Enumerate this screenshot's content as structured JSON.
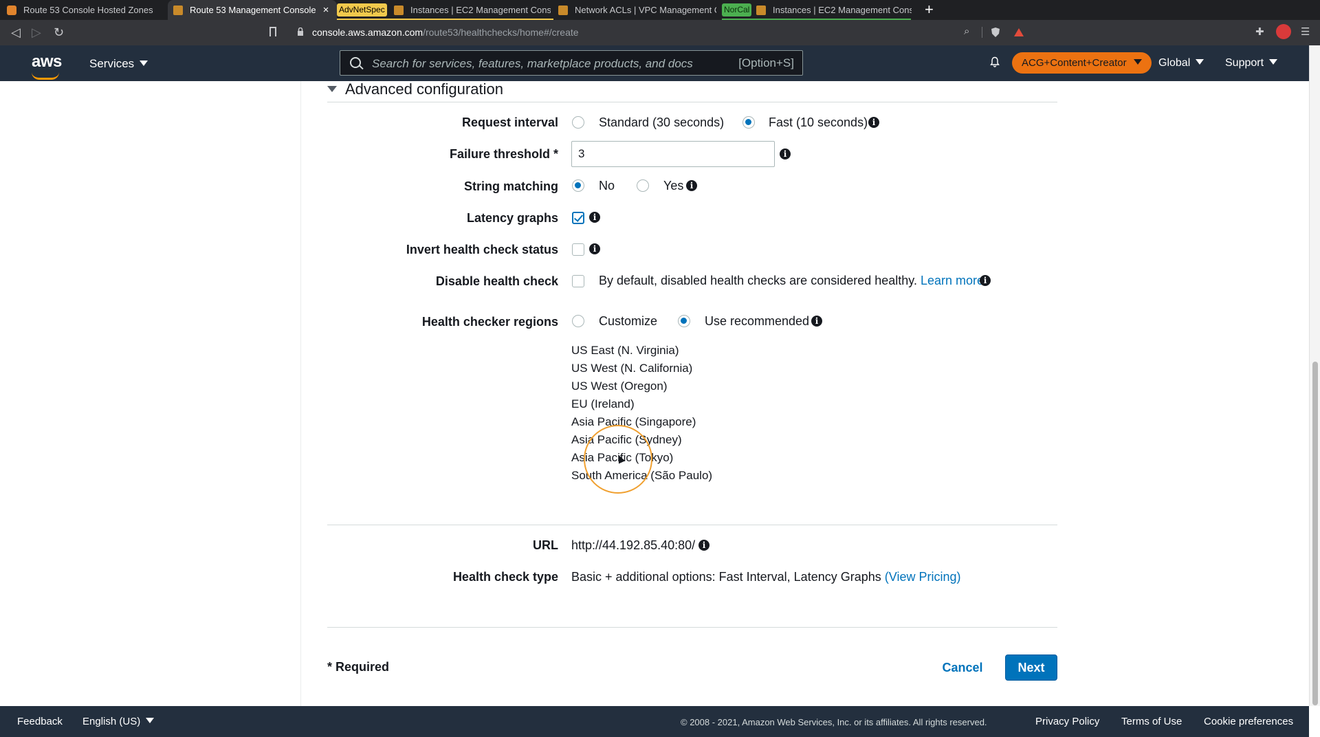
{
  "browser": {
    "tabs": [
      {
        "label": "Route 53 Console Hosted Zones"
      },
      {
        "label": "Route 53 Management Console",
        "close": "×"
      },
      {
        "tag": "AdvNetSpec",
        "label": "Instances | EC2 Management Conso"
      },
      {
        "label": "Network ACLs | VPC Management C"
      },
      {
        "tag": "NorCal",
        "label": "Instances | EC2 Management Conso"
      }
    ],
    "new_tab": "+",
    "url_host": "console.aws.amazon.com",
    "url_path": "/route53/healthchecks/home#/create"
  },
  "nav": {
    "logo": "aws",
    "services": "Services",
    "search_placeholder": "Search for services, features, marketplace products, and docs",
    "search_shortcut": "[Option+S]",
    "account": "ACG+Content+Creator",
    "region": "Global",
    "support": "Support"
  },
  "form": {
    "section_title": "Advanced configuration",
    "request_interval": {
      "label": "Request interval",
      "options": [
        "Standard (30 seconds)",
        "Fast (10 seconds)"
      ],
      "selected": "Fast (10 seconds)"
    },
    "failure_threshold": {
      "label": "Failure threshold *",
      "value": "3"
    },
    "string_matching": {
      "label": "String matching",
      "options": [
        "No",
        "Yes"
      ],
      "selected": "No"
    },
    "latency_graphs": {
      "label": "Latency graphs",
      "checked": true
    },
    "invert_status": {
      "label": "Invert health check status",
      "checked": false
    },
    "disable_check": {
      "label": "Disable health check",
      "checked": false,
      "text": "By default, disabled health checks are considered healthy.",
      "link": "Learn more"
    },
    "regions": {
      "label": "Health checker regions",
      "options": [
        "Customize",
        "Use recommended"
      ],
      "selected": "Use recommended",
      "list": [
        "US East (N. Virginia)",
        "US West (N. California)",
        "US West (Oregon)",
        "EU (Ireland)",
        "Asia Pacific (Singapore)",
        "Asia Pacific (Sydney)",
        "Asia Pacific (Tokyo)",
        "South America (São Paulo)"
      ]
    },
    "url": {
      "label": "URL",
      "value": "http://44.192.85.40:80/"
    },
    "check_type": {
      "label": "Health check type",
      "value": "Basic + additional options: Fast Interval, Latency Graphs",
      "link": "(View Pricing)"
    },
    "required_note": "* Required",
    "cancel": "Cancel",
    "next": "Next"
  },
  "footer": {
    "feedback": "Feedback",
    "language": "English (US)",
    "copyright": "© 2008 - 2021, Amazon Web Services, Inc. or its affiliates. All rights reserved.",
    "privacy": "Privacy Policy",
    "terms": "Terms of Use",
    "cookies": "Cookie preferences"
  },
  "colors": {
    "accent": "#0073bb",
    "nav_bg": "#232f3e",
    "account_pill": "#ec7211",
    "aws_orange": "#ff9900"
  }
}
